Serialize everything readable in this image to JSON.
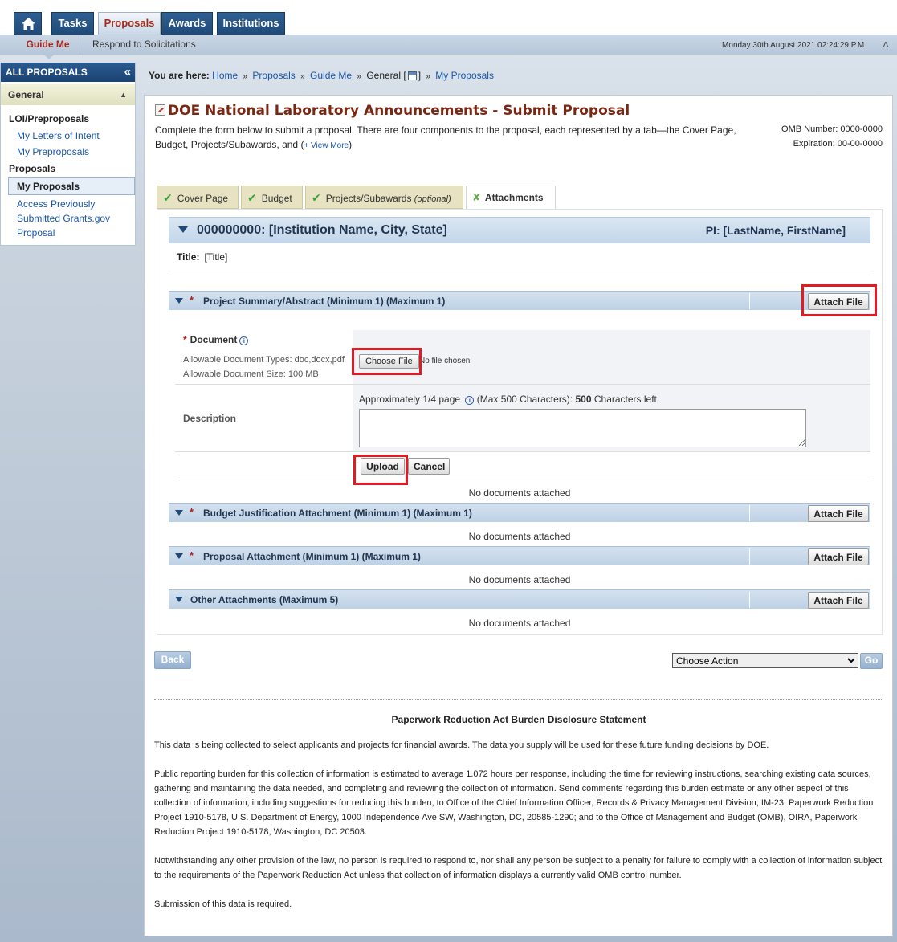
{
  "topnav": {
    "tabs": [
      "Tasks",
      "Proposals",
      "Awards",
      "Institutions"
    ],
    "active": "Proposals"
  },
  "subnav": {
    "guide_me": "Guide Me",
    "respond": "Respond to Solicitations",
    "datetime": "Monday 30th August 2021 02:24:29 P.M."
  },
  "sidebar": {
    "header": "ALL PROPOSALS",
    "section": "General",
    "group1": "LOI/Preproposals",
    "group1_items": [
      "My Letters of Intent",
      "My Preproposals"
    ],
    "group2": "Proposals",
    "group2_items": [
      "My Proposals",
      "Access Previously Submitted Grants.gov Proposal"
    ]
  },
  "breadcrumb": {
    "label": "You are here:",
    "home": "Home",
    "proposals": "Proposals",
    "guide_me": "Guide Me",
    "general": "General [",
    "general_end": "]",
    "my_proposals": "My Proposals",
    "sep": "»"
  },
  "page": {
    "title": "DOE National Laboratory Announcements - Submit Proposal",
    "intro": "Complete the form below to submit a proposal. There are four components to the proposal, each represented by a tab—the Cover Page, Budget, Projects/Subawards, and (",
    "view_more": "+ View More",
    "intro_end": ")",
    "omb_label": "OMB Number:",
    "omb_value": "0000-0000",
    "exp_label": "Expiration:",
    "exp_value": "00-00-0000"
  },
  "tabs": {
    "cover": "Cover Page",
    "budget": "Budget",
    "projects": "Projects/Subawards",
    "projects_opt": "(optional)",
    "attachments": "Attachments"
  },
  "institution": {
    "name": "000000000: [Institution Name, City, State]",
    "pi": "PI: [LastName, FirstName]",
    "title_label": "Title:",
    "title_value": "[Title]"
  },
  "sections": [
    {
      "title": "Project Summary/Abstract (Minimum 1) (Maximum 1)",
      "required": true,
      "status": "No documents attached"
    },
    {
      "title": "Budget Justification Attachment (Minimum 1) (Maximum 1)",
      "required": true,
      "status": "No documents attached"
    },
    {
      "title": "Proposal Attachment (Minimum 1) (Maximum 1)",
      "required": true,
      "status": "No documents attached"
    },
    {
      "title": "Other Attachments (Maximum 5)",
      "required": false,
      "status": "No documents attached"
    }
  ],
  "form": {
    "attach_file": "Attach File",
    "document_label": "Document",
    "allowed_types": "Allowable Document Types: doc,docx,pdf",
    "allowed_size": "Allowable Document Size: 100 MB",
    "choose_file": "Choose File",
    "no_file": "No file chosen",
    "description_label": "Description",
    "desc_help_pre": "Approximately 1/4 page",
    "desc_help_mid": "(Max 500 Characters):",
    "chars_left": "500",
    "desc_help_post": "Characters left.",
    "upload": "Upload",
    "cancel": "Cancel"
  },
  "actions": {
    "back": "Back",
    "choose_action": "Choose Action",
    "go": "Go"
  },
  "pra": {
    "title": "Paperwork Reduction Act Burden Disclosure Statement",
    "p1": "This data is being collected to select applicants and projects for financial awards. The data you supply will be used for these future funding decisions by DOE.",
    "p2": "Public reporting burden for this collection of information is estimated to average 1.072 hours per response, including the time for reviewing instructions, searching existing data sources, gathering and maintaining the data needed, and completing and reviewing the collection of information. Send comments regarding this burden estimate or any other aspect of this collection of information, including suggestions for reducing this burden, to Office of the Chief Information Officer, Records & Privacy Management Division, IM-23, Paperwork Reduction Project 1910-5178, U.S. Department of Energy, 1000 Independence Ave SW, Washington, DC, 20585-1290; and to the Office of Management and Budget (OMB), OIRA, Paperwork Reduction Project 1910-5178, Washington, DC 20503.",
    "p3": "Notwithstanding any other provision of the law, no person is required to respond to, nor shall any person be subject to a penalty for failure to comply with a collection of information subject to the requirements of the Paperwork Reduction Act unless that collection of information displays a currently valid OMB control number.",
    "p4": "Submission of this data is required."
  },
  "icons": [
    "home-icon",
    "calendar-icon",
    "info-icon",
    "checkmark-icon",
    "tools-icon",
    "collapse-icon"
  ],
  "colors": {
    "nav": "#1f4a78",
    "accent": "#a32a1c",
    "highlight": "#e01b24",
    "link": "#1a56a8"
  }
}
